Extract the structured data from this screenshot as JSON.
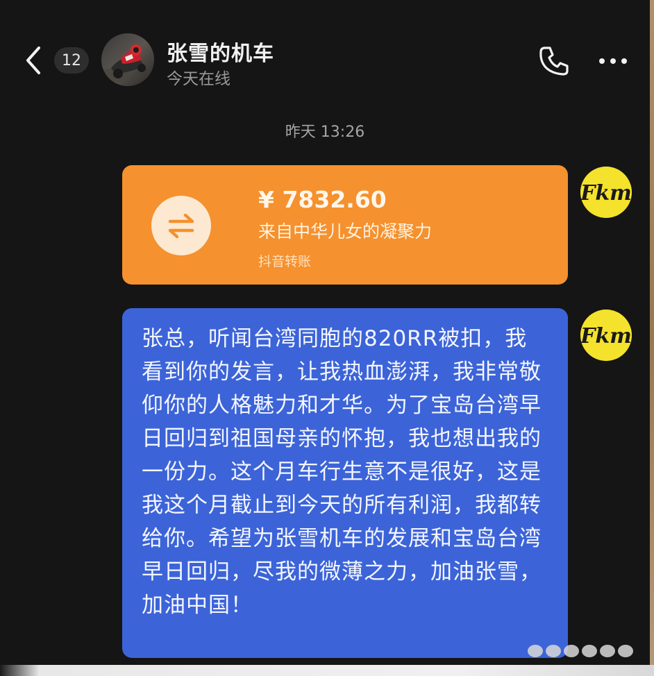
{
  "header": {
    "unread_count": "12",
    "chat_name": "张雪的机车",
    "status": "今天在线"
  },
  "conversation": {
    "timestamp": "昨天 13:26",
    "transfer": {
      "amount": "¥ 7832.60",
      "note": "来自中华儿女的凝聚力",
      "source": "抖音转账",
      "color": "#f5912e"
    },
    "message": {
      "text": "张总，听闻台湾同胞的820RR被扣，我看到你的发言，让我热血澎湃，我非常敬仰你的人格魅力和才华。为了宝岛台湾早日回归到祖国母亲的怀抱，我也想出我的一份力。这个月车行生意不是很好，这是我这个月截止到今天的所有利润，我都转给你。希望为张雪机车的发展和宝岛台湾早日回归，尽我的微薄之力，加油张雪，加油中国！",
      "color": "#3c64d8"
    }
  },
  "icons": {
    "back": "chevron-left-icon",
    "call": "phone-icon",
    "more": "more-dots-icon",
    "transfer": "swap-arrows-icon"
  },
  "self_avatar_logo_text": "Fkm"
}
